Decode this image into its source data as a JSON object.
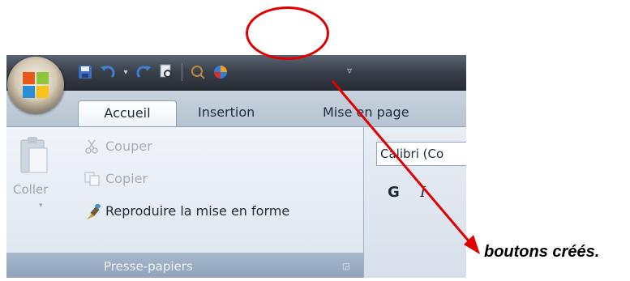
{
  "quick_access_toolbar": {
    "icons": [
      "save-icon",
      "undo-icon",
      "undo-dropdown-icon",
      "redo-icon",
      "print-preview-icon",
      "custom-button-1-icon",
      "custom-button-2-icon",
      "customize-toolbar-icon"
    ]
  },
  "tabs": [
    {
      "label": "Accueil",
      "active": true
    },
    {
      "label": "Insertion",
      "active": false
    },
    {
      "label": "Mise en page",
      "active": false
    }
  ],
  "clipboard_group": {
    "paste_label": "Coller",
    "cut_label": "Couper",
    "copy_label": "Copier",
    "format_painter_label": "Reproduire la mise en forme",
    "group_title": "Presse-papiers"
  },
  "font_group": {
    "font_name": "Calibri (Co",
    "bold_label": "G",
    "italic_label": "I"
  },
  "annotation": {
    "caption": "boutons créés.",
    "color": "#e00000"
  },
  "colors": {
    "titlebar": "#3a414c",
    "ribbon": "#dce5ef",
    "accent_red": "#e00000"
  }
}
